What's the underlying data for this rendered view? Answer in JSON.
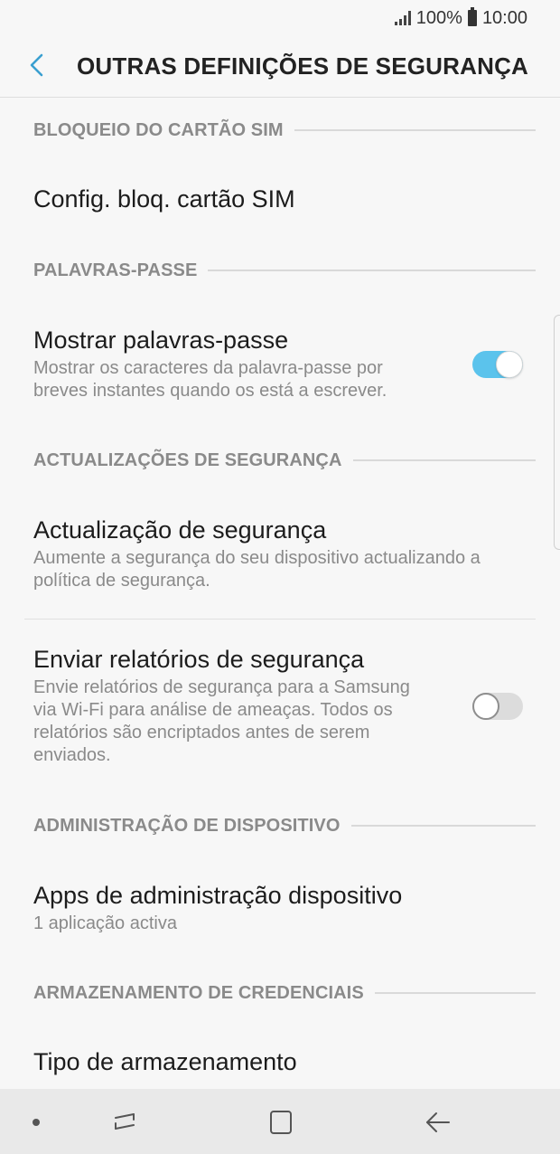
{
  "status_bar": {
    "battery": "100%",
    "time": "10:00"
  },
  "header": {
    "back_icon": "chevron-left-icon",
    "title": "OUTRAS DEFINIÇÕES DE SEGURANÇA"
  },
  "sections": {
    "sim_lock": {
      "header": "BLOQUEIO DO CARTÃO SIM",
      "item_title": "Config. bloq. cartão SIM"
    },
    "passwords": {
      "header": "PALAVRAS-PASSE",
      "item_title": "Mostrar palavras-passe",
      "item_summary": "Mostrar os caracteres da palavra-passe por breves instantes quando os está a escrever.",
      "toggle": true
    },
    "security_updates": {
      "header": "ACTUALIZAÇÕES DE SEGURANÇA",
      "update_title": "Actualização de segurança",
      "update_summary": "Aumente a segurança do seu dispositivo actualizando a política de segurança.",
      "reports_title": "Enviar relatórios de segurança",
      "reports_summary": "Envie relatórios de segurança para a Samsung via Wi-Fi para análise de ameaças. Todos os relatórios são encriptados antes de serem enviados.",
      "reports_toggle": false
    },
    "device_admin": {
      "header": "ADMINISTRAÇÃO DE DISPOSITIVO",
      "item_title": "Apps de administração dispositivo",
      "item_summary": "1 aplicação activa"
    },
    "credential_storage": {
      "header": "ARMAZENAMENTO DE CREDENCIAIS",
      "item_title": "Tipo de armazenamento"
    }
  },
  "colors": {
    "accent": "#5bc3ec",
    "section_header": "#8a8a8a",
    "background": "#f7f7f7"
  },
  "nav_bar": {
    "recents_icon": "recents-icon",
    "home_icon": "home-icon",
    "back_icon": "back-arrow-icon"
  }
}
